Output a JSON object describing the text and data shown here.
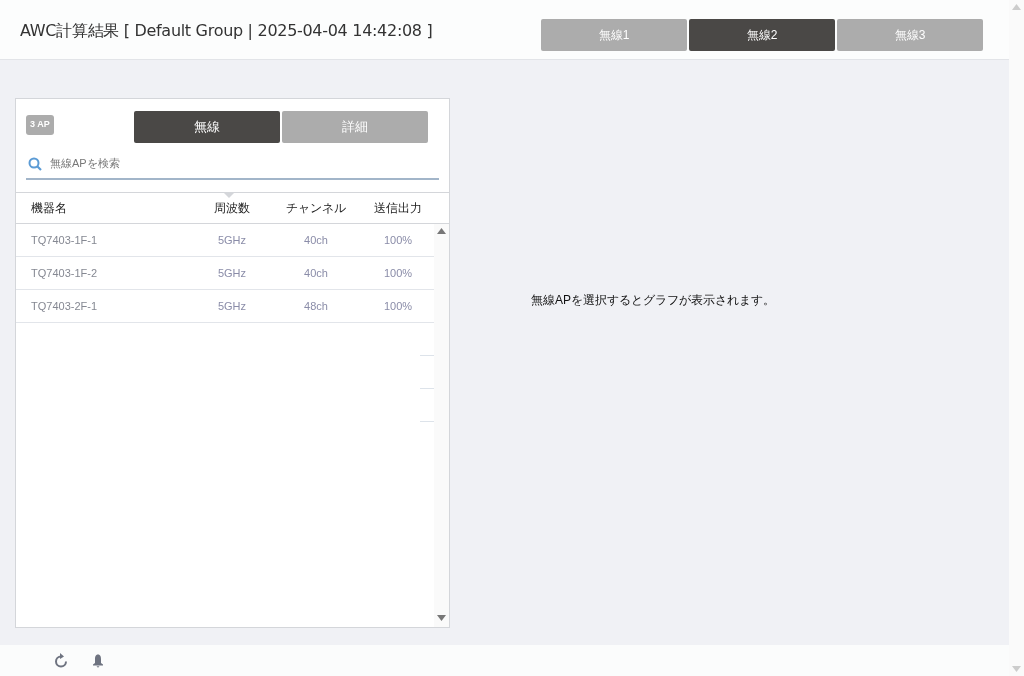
{
  "header": {
    "title": "AWC計算結果 [ Default Group | 2025-04-04 14:42:08 ]",
    "tabs": [
      {
        "label": "無線1",
        "selected": false
      },
      {
        "label": "無線2",
        "selected": true
      },
      {
        "label": "無線3",
        "selected": false
      }
    ]
  },
  "panel": {
    "badge": "3 AP",
    "tabs": [
      {
        "label": "無線",
        "selected": true
      },
      {
        "label": "詳細",
        "selected": false
      }
    ],
    "search": {
      "placeholder": "無線APを検索"
    },
    "table": {
      "columns": [
        "機器名",
        "周波数",
        "チャンネル",
        "送信出力"
      ],
      "rows": [
        [
          "TQ7403-1F-1",
          "5GHz",
          "40ch",
          "100%"
        ],
        [
          "TQ7403-1F-2",
          "5GHz",
          "40ch",
          "100%"
        ],
        [
          "TQ7403-2F-1",
          "5GHz",
          "48ch",
          "100%"
        ]
      ]
    }
  },
  "message": "無線APを選択するとグラフが表示されます。"
}
